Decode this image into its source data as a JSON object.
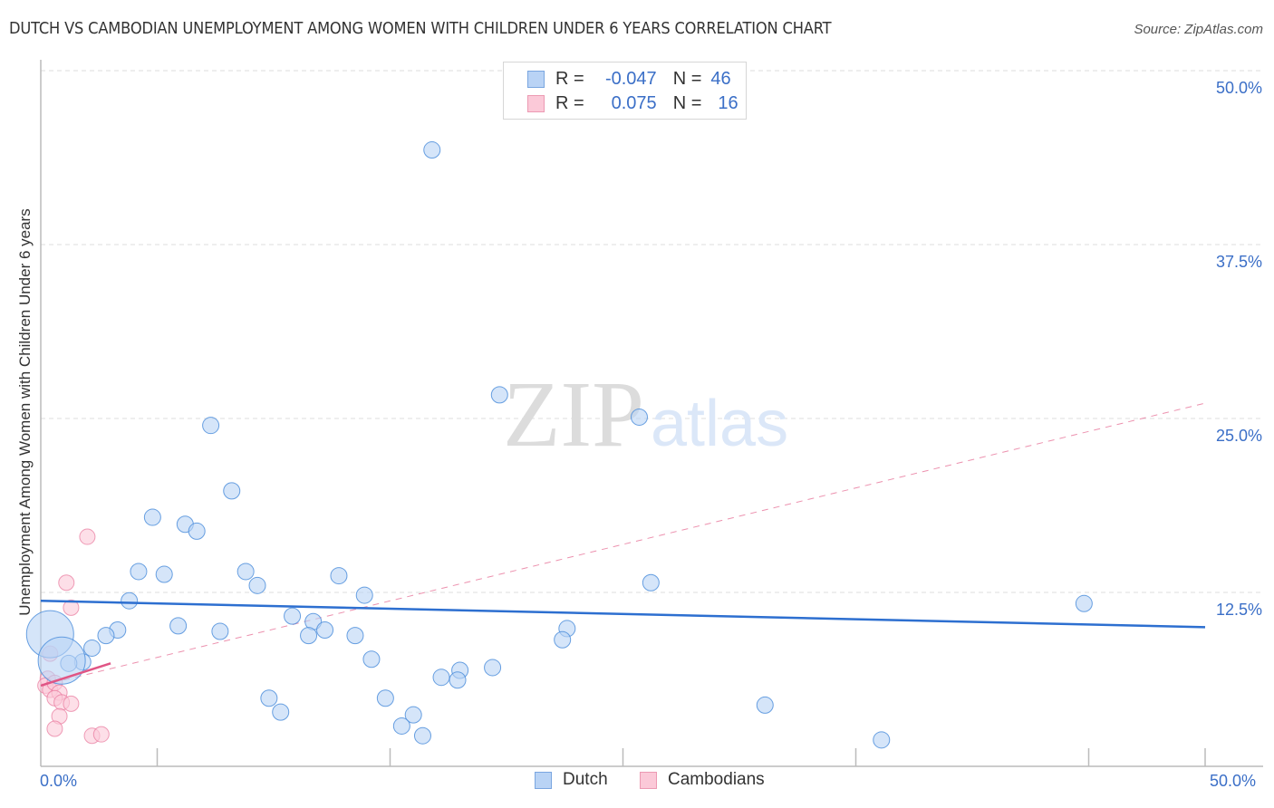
{
  "title": "DUTCH VS CAMBODIAN UNEMPLOYMENT AMONG WOMEN WITH CHILDREN UNDER 6 YEARS CORRELATION CHART",
  "source": "Source: ZipAtlas.com",
  "watermark": {
    "zip": "ZIP",
    "atlas": "atlas"
  },
  "legend": {
    "rows": [
      {
        "r_label": "R =",
        "r_value": "-0.047",
        "n_label": "N =",
        "n_value": "46",
        "color": "#b9d3f5",
        "border": "#7aa6e0"
      },
      {
        "r_label": "R =",
        "r_value": "0.075",
        "n_label": "N =",
        "n_value": "16",
        "color": "#fbc9d8",
        "border": "#ec9ab3"
      }
    ]
  },
  "bottom_legend": [
    {
      "label": "Dutch",
      "color": "#b9d3f5",
      "border": "#7aa6e0"
    },
    {
      "label": "Cambodians",
      "color": "#fbc9d8",
      "border": "#ec9ab3"
    }
  ],
  "chart_data": {
    "type": "scatter",
    "title": "DUTCH VS CAMBODIAN UNEMPLOYMENT AMONG WOMEN WITH CHILDREN UNDER 6 YEARS CORRELATION CHART",
    "xlabel": "",
    "ylabel": "Unemployment Among Women with Children Under 6 years",
    "xlim": [
      0,
      50
    ],
    "ylim": [
      0,
      50
    ],
    "x_tick_labels": [
      "0.0%",
      "50.0%"
    ],
    "y_tick_labels": [
      {
        "value": 50,
        "label": "50.0%"
      },
      {
        "value": 37.5,
        "label": "37.5%"
      },
      {
        "value": 25,
        "label": "25.0%"
      },
      {
        "value": 12.5,
        "label": "12.5%"
      }
    ],
    "x_minor_ticks": [
      0,
      5,
      10,
      15,
      20,
      25,
      30,
      35,
      40,
      45,
      50
    ],
    "grid": "horizontal-dashed",
    "legend_position": "top-center",
    "series": [
      {
        "name": "Dutch",
        "color": "#4f8fdc",
        "fill": "#b9d3f5",
        "R": -0.047,
        "N": 46,
        "trend": {
          "x": [
            0,
            50
          ],
          "y": [
            11.9,
            10.0
          ],
          "style": "solid"
        },
        "points": [
          {
            "x": 16.8,
            "y": 44.3
          },
          {
            "x": 19.7,
            "y": 26.7
          },
          {
            "x": 25.7,
            "y": 25.1
          },
          {
            "x": 7.3,
            "y": 24.5
          },
          {
            "x": 8.2,
            "y": 19.8
          },
          {
            "x": 4.8,
            "y": 17.9
          },
          {
            "x": 6.2,
            "y": 17.4
          },
          {
            "x": 6.7,
            "y": 16.9
          },
          {
            "x": 4.2,
            "y": 14.0
          },
          {
            "x": 5.3,
            "y": 13.8
          },
          {
            "x": 8.8,
            "y": 14.0
          },
          {
            "x": 9.3,
            "y": 13.0
          },
          {
            "x": 12.8,
            "y": 13.7
          },
          {
            "x": 13.9,
            "y": 12.3
          },
          {
            "x": 26.2,
            "y": 13.2
          },
          {
            "x": 44.8,
            "y": 11.7
          },
          {
            "x": 3.8,
            "y": 11.9
          },
          {
            "x": 10.8,
            "y": 10.8
          },
          {
            "x": 11.7,
            "y": 10.4
          },
          {
            "x": 12.2,
            "y": 9.8
          },
          {
            "x": 11.5,
            "y": 9.4
          },
          {
            "x": 13.5,
            "y": 9.4
          },
          {
            "x": 5.9,
            "y": 10.1
          },
          {
            "x": 7.7,
            "y": 9.7
          },
          {
            "x": 3.3,
            "y": 9.8
          },
          {
            "x": 2.8,
            "y": 9.4
          },
          {
            "x": 22.6,
            "y": 9.9
          },
          {
            "x": 22.4,
            "y": 9.1
          },
          {
            "x": 14.2,
            "y": 7.7
          },
          {
            "x": 19.4,
            "y": 7.1
          },
          {
            "x": 18.0,
            "y": 6.9
          },
          {
            "x": 17.2,
            "y": 6.4
          },
          {
            "x": 17.9,
            "y": 6.2
          },
          {
            "x": 2.2,
            "y": 8.5
          },
          {
            "x": 1.8,
            "y": 7.5
          },
          {
            "x": 1.2,
            "y": 7.4
          },
          {
            "x": 0.4,
            "y": 9.5,
            "size": "large"
          },
          {
            "x": 9.8,
            "y": 4.9
          },
          {
            "x": 10.3,
            "y": 3.9
          },
          {
            "x": 14.8,
            "y": 4.9
          },
          {
            "x": 16.0,
            "y": 3.7
          },
          {
            "x": 15.5,
            "y": 2.9
          },
          {
            "x": 16.4,
            "y": 2.2
          },
          {
            "x": 31.1,
            "y": 4.4
          },
          {
            "x": 36.1,
            "y": 1.9
          },
          {
            "x": 0.9,
            "y": 7.6,
            "size": "large"
          }
        ]
      },
      {
        "name": "Cambodians",
        "color": "#e8769b",
        "fill": "#fbc9d8",
        "R": 0.075,
        "N": 16,
        "trend": {
          "x": [
            0,
            3.0
          ],
          "y": [
            5.8,
            7.4
          ],
          "style": "solid",
          "extended": {
            "x": [
              0,
              50
            ],
            "y": [
              5.8,
              26.1
            ],
            "style": "dashed"
          }
        },
        "points": [
          {
            "x": 2.0,
            "y": 16.5
          },
          {
            "x": 1.1,
            "y": 13.2
          },
          {
            "x": 1.3,
            "y": 11.4
          },
          {
            "x": 0.4,
            "y": 8.1
          },
          {
            "x": 0.3,
            "y": 6.3
          },
          {
            "x": 0.2,
            "y": 5.8
          },
          {
            "x": 0.4,
            "y": 5.5
          },
          {
            "x": 0.6,
            "y": 6.0
          },
          {
            "x": 0.8,
            "y": 5.3
          },
          {
            "x": 0.6,
            "y": 4.9
          },
          {
            "x": 0.9,
            "y": 4.6
          },
          {
            "x": 1.3,
            "y": 4.5
          },
          {
            "x": 0.8,
            "y": 3.6
          },
          {
            "x": 0.6,
            "y": 2.7
          },
          {
            "x": 2.2,
            "y": 2.2
          },
          {
            "x": 2.6,
            "y": 2.3
          }
        ]
      }
    ]
  }
}
